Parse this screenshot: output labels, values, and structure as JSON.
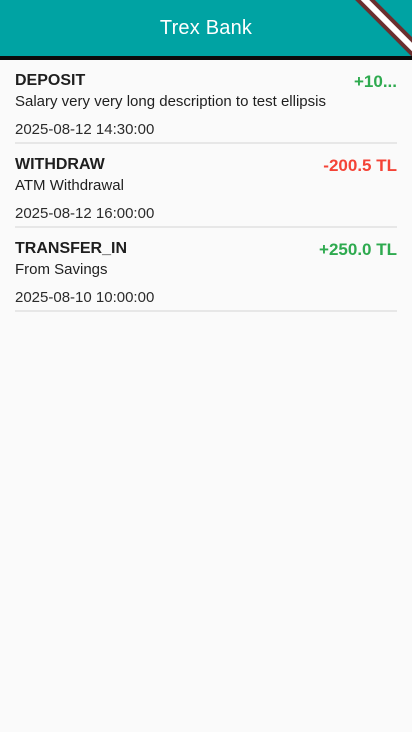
{
  "appbar": {
    "title": "Trex Bank"
  },
  "transactions": [
    {
      "type": "DEPOSIT",
      "description": "Salary very very long description to test ellipsis",
      "date": "2025-08-12 14:30:00",
      "amount": "+10...",
      "amount_color": "#2eaa4f"
    },
    {
      "type": "WITHDRAW",
      "description": "ATM Withdrawal",
      "date": "2025-08-12 16:00:00",
      "amount": "-200.5 TL",
      "amount_color": "#f44336"
    },
    {
      "type": "TRANSFER_IN",
      "description": "From Savings",
      "date": "2025-08-10 10:00:00",
      "amount": "+250.0 TL",
      "amount_color": "#2eaa4f"
    }
  ],
  "colors": {
    "appbar": "#00a3a3",
    "background": "#fafafa"
  }
}
